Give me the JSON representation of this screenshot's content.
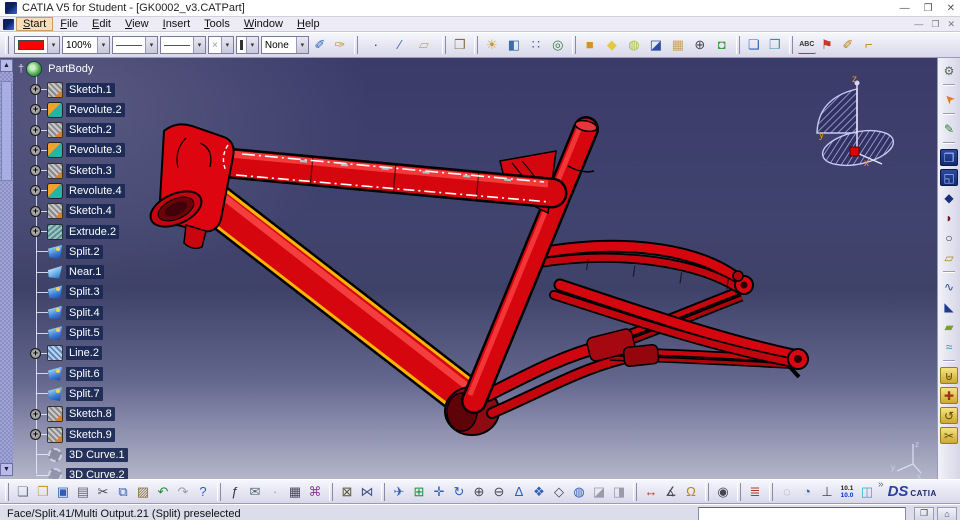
{
  "window": {
    "title": "CATIA V5 for Student - [GK0002_v3.CATPart]",
    "controls": {
      "minimize": "—",
      "restore": "❐",
      "close": "✕"
    }
  },
  "doc_controls": {
    "minimize": "—",
    "restore": "❐",
    "close": "✕"
  },
  "menu": {
    "items": [
      {
        "label": "Start",
        "highlight": true
      },
      {
        "label": "File"
      },
      {
        "label": "Edit"
      },
      {
        "label": "View"
      },
      {
        "label": "Insert"
      },
      {
        "label": "Tools"
      },
      {
        "label": "Window"
      },
      {
        "label": "Help"
      }
    ]
  },
  "graphic_props": {
    "fill_color": "#ff0000",
    "zoom_level": "100%",
    "point_symbol": "×",
    "render_material": "None",
    "dropdown_arrow": "▾"
  },
  "toolbar_icons_a": [
    {
      "name": "painter-icon",
      "glyph": "✐",
      "color": "#2f5fb3"
    },
    {
      "name": "copy-graphic-properties-icon",
      "glyph": "✑",
      "color": "#c99a2e"
    }
  ],
  "toolbar_icons_b": [
    {
      "name": "point-icon",
      "glyph": "·",
      "color": "#16307a"
    },
    {
      "name": "line-icon",
      "glyph": "∕",
      "color": "#2f5fb3"
    },
    {
      "name": "plane-icon",
      "glyph": "▱",
      "color": "#b8b83a"
    }
  ],
  "toolbar_icons_c": [
    {
      "name": "open-box-icon",
      "glyph": "❒",
      "color": "#8a6d3b"
    }
  ],
  "toolbar_icons_d": [
    {
      "name": "light-source-icon",
      "glyph": "☀",
      "color": "#c99a2e"
    },
    {
      "name": "depth-effect-icon",
      "glyph": "◧",
      "color": "#3a6ea5"
    },
    {
      "name": "grid-icon",
      "glyph": "∷",
      "color": "#5555bb"
    },
    {
      "name": "snap-to-point-icon",
      "glyph": "◎",
      "color": "#2e7d32"
    }
  ],
  "toolbar_icons_e": [
    {
      "name": "view-shading-icon",
      "glyph": "■",
      "color": "#d98e2b"
    },
    {
      "name": "view-shading-edges-icon",
      "glyph": "◆",
      "color": "#e2c93f"
    },
    {
      "name": "view-material-icon",
      "glyph": "◍",
      "color": "#a9c13e"
    },
    {
      "name": "view-wireframe-icon",
      "glyph": "◪",
      "color": "#2f4d9e"
    },
    {
      "name": "view-hidden-line-icon",
      "glyph": "▦",
      "color": "#c8a06a"
    },
    {
      "name": "view-perspective-icon",
      "glyph": "⊕",
      "color": "#444455"
    },
    {
      "name": "view-ground-icon",
      "glyph": "◘",
      "color": "#3f9b44"
    }
  ],
  "toolbar_icons_f": [
    {
      "name": "tile-horizontally-icon",
      "glyph": "❏",
      "color": "#2f5fb3"
    },
    {
      "name": "tile-vertically-icon",
      "glyph": "❐",
      "color": "#2f8fb3"
    }
  ],
  "toolbar_icons_g": [
    {
      "name": "flag-note-icon",
      "glyph": "⚑",
      "color": "#c23a2a"
    },
    {
      "name": "annotation-painter-icon",
      "glyph": "✐",
      "color": "#b8860b"
    },
    {
      "name": "key-lock-icon",
      "glyph": "⌐",
      "color": "#b8860b"
    }
  ],
  "abc_label": "ABC",
  "tree": {
    "root": {
      "label": "PartBody",
      "anchor_glyph": "†"
    },
    "items": [
      {
        "label": "Sketch.1",
        "icon": "sketch",
        "expandable": true
      },
      {
        "label": "Revolute.2",
        "icon": "revolute",
        "expandable": true
      },
      {
        "label": "Sketch.2",
        "icon": "sketch",
        "expandable": true
      },
      {
        "label": "Revolute.3",
        "icon": "revolute",
        "expandable": true
      },
      {
        "label": "Sketch.3",
        "icon": "sketch",
        "expandable": true
      },
      {
        "label": "Revolute.4",
        "icon": "revolute",
        "expandable": true
      },
      {
        "label": "Sketch.4",
        "icon": "sketch",
        "expandable": true
      },
      {
        "label": "Extrude.2",
        "icon": "extrude",
        "expandable": true
      },
      {
        "label": "Split.2",
        "icon": "split",
        "expandable": false
      },
      {
        "label": "Near.1",
        "icon": "near",
        "expandable": false
      },
      {
        "label": "Split.3",
        "icon": "split",
        "expandable": false
      },
      {
        "label": "Split.4",
        "icon": "split",
        "expandable": false
      },
      {
        "label": "Split.5",
        "icon": "split",
        "expandable": false
      },
      {
        "label": "Line.2",
        "icon": "line",
        "expandable": true
      },
      {
        "label": "Split.6",
        "icon": "split",
        "expandable": false
      },
      {
        "label": "Split.7",
        "icon": "split",
        "expandable": false
      },
      {
        "label": "Sketch.8",
        "icon": "sketch",
        "expandable": true
      },
      {
        "label": "Sketch.9",
        "icon": "sketch",
        "expandable": true
      },
      {
        "label": "3D Curve.1",
        "icon": "curve3d",
        "expandable": false
      },
      {
        "label": "3D Curve.2",
        "icon": "curve3d",
        "expandable": false
      }
    ],
    "expander_glyph": "+"
  },
  "viewport": {
    "compass": {
      "x": "x",
      "y": "y",
      "z": "z"
    },
    "triad": {
      "x": "x",
      "y": "y",
      "z": "z"
    },
    "frame_color": "#e00713",
    "selected_outline": "#ffb400",
    "centerline_color": "#ffffff"
  },
  "right_tools": [
    {
      "name": "gear-icon",
      "glyph": "⚙",
      "color": "#556655"
    },
    {
      "sep": true
    },
    {
      "name": "select-cursor-icon",
      "glyph": "➤",
      "color": "#e07b20",
      "rot": true
    },
    {
      "sep": true
    },
    {
      "name": "sketcher-icon",
      "glyph": "✎",
      "color": "#2e7d32"
    },
    {
      "sep": true
    },
    {
      "name": "pad-icon",
      "glyph": "❒",
      "color": "#9fb6ff",
      "chip": "chip-navy"
    },
    {
      "name": "pocket-icon",
      "glyph": "◱",
      "color": "#9fb6ff",
      "chip": "chip-navy"
    },
    {
      "name": "split-solid-icon",
      "glyph": "◆",
      "color": "#16307a"
    },
    {
      "name": "close-surface-icon",
      "glyph": "◗",
      "color": "#7a1020"
    },
    {
      "name": "cylinder-icon",
      "glyph": "○",
      "color": "#333344"
    },
    {
      "name": "extrude-surface-icon",
      "glyph": "▱",
      "color": "#a8882a"
    },
    {
      "sep": true
    },
    {
      "name": "sweep-icon",
      "glyph": "∿",
      "color": "#2f4d9e"
    },
    {
      "name": "wedge-icon",
      "glyph": "◣",
      "color": "#1d3a8f"
    },
    {
      "name": "fill-icon",
      "glyph": "▰",
      "color": "#7aa12e"
    },
    {
      "name": "blend-icon",
      "glyph": "≈",
      "color": "#2f8fb3"
    },
    {
      "sep": true
    },
    {
      "name": "join-icon",
      "glyph": "⊎",
      "color": "#5a4a10",
      "chip": "chip-yellow"
    },
    {
      "name": "healing-icon",
      "glyph": "✚",
      "color": "#a03020",
      "chip": "chip-yellow"
    },
    {
      "name": "untrim-icon",
      "glyph": "↺",
      "color": "#5a4a10",
      "chip": "chip-yellow"
    },
    {
      "name": "disassemble-icon",
      "glyph": "✂",
      "color": "#5a4a10",
      "chip": "chip-yellow"
    }
  ],
  "bottom_groups": [
    [
      {
        "name": "new-icon",
        "glyph": "❏",
        "color": "#667788"
      },
      {
        "name": "open-icon",
        "glyph": "❐",
        "color": "#c99a2e"
      },
      {
        "name": "save-icon",
        "glyph": "▣",
        "color": "#2f5fb3"
      },
      {
        "name": "print-icon",
        "glyph": "▤",
        "color": "#666677"
      },
      {
        "name": "cut-icon",
        "glyph": "✂",
        "color": "#444455"
      },
      {
        "name": "copy-icon",
        "glyph": "⧉",
        "color": "#2f5fb3"
      },
      {
        "name": "paste-icon",
        "glyph": "▨",
        "color": "#8a6d3b"
      },
      {
        "name": "undo-icon",
        "glyph": "↶",
        "color": "#1f8a3a"
      },
      {
        "name": "redo-icon",
        "glyph": "↷",
        "color": "#9a9aaa"
      },
      {
        "name": "whats-this-icon",
        "glyph": "?",
        "color": "#2f5fb3"
      }
    ],
    [
      {
        "name": "formula-icon",
        "glyph": "ƒ",
        "color": "#333344"
      },
      {
        "name": "knowledge-icon",
        "glyph": "✉",
        "color": "#556677"
      },
      {
        "name": "parameter-icon",
        "glyph": "·",
        "color": "#9a9aaa"
      },
      {
        "name": "design-table-icon",
        "glyph": "▦",
        "color": "#444455"
      },
      {
        "name": "product-structure-icon",
        "glyph": "⌘",
        "color": "#953a9e"
      }
    ],
    [
      {
        "name": "lock-icon",
        "glyph": "⊠",
        "color": "#555533"
      },
      {
        "name": "links-icon",
        "glyph": "⋈",
        "color": "#445588"
      }
    ],
    [
      {
        "name": "fly-mode-icon",
        "glyph": "✈",
        "color": "#2f5fb3"
      },
      {
        "name": "fit-all-in-icon",
        "glyph": "⊞",
        "color": "#1f8a3a"
      },
      {
        "name": "pan-icon",
        "glyph": "✛",
        "color": "#2f5fb3"
      },
      {
        "name": "rotate-icon",
        "glyph": "↻",
        "color": "#2f5fb3"
      },
      {
        "name": "zoom-in-icon",
        "glyph": "⊕",
        "color": "#444455"
      },
      {
        "name": "zoom-out-icon",
        "glyph": "⊖",
        "color": "#444455"
      },
      {
        "name": "normal-view-icon",
        "glyph": "∆",
        "color": "#2f5fb3"
      },
      {
        "name": "multi-view-icon",
        "glyph": "❖",
        "color": "#2f5fb3"
      },
      {
        "name": "iso-view-icon",
        "glyph": "◇",
        "color": "#444455"
      },
      {
        "name": "render-style-icon",
        "glyph": "◍",
        "color": "#2f5fb3"
      },
      {
        "name": "hide-show-icon",
        "glyph": "◪",
        "color": "#9a9aaa"
      },
      {
        "name": "swap-space-icon",
        "glyph": "◨",
        "color": "#9a9aaa"
      }
    ],
    [
      {
        "name": "measure-between-icon",
        "glyph": "↔",
        "color": "#b33a2a"
      },
      {
        "name": "measure-item-icon",
        "glyph": "∡",
        "color": "#444455"
      },
      {
        "name": "mass-properties-icon",
        "glyph": "Ω",
        "color": "#b8860b"
      }
    ],
    [
      {
        "name": "capture-icon",
        "glyph": "◉",
        "color": "#444455"
      }
    ],
    [
      {
        "name": "gauge-icon",
        "glyph": "≣",
        "color": "#b33a2a"
      }
    ],
    [
      {
        "name": "recycle-icon",
        "glyph": "◌",
        "color": "#9a9aaa"
      },
      {
        "name": "update-icon",
        "glyph": "◔",
        "color": "#2f5fb3"
      },
      {
        "name": "axis-system-icon",
        "glyph": "⊥",
        "color": "#444455"
      },
      {
        "name": "units-icon",
        "units": true
      },
      {
        "name": "catalog-icon",
        "glyph": "◫",
        "color": "#28b0c9"
      }
    ]
  ],
  "units_icon": {
    "top": "10.1",
    "bottom": "10.0"
  },
  "chevron": "»",
  "logo": {
    "ds": "DS",
    "catia": "CATIA"
  },
  "status": {
    "message": "Face/Split.41/Multi Output.21 (Split) preselected",
    "input_value": "",
    "buttons": [
      {
        "name": "power-input-expand-button",
        "glyph": "❐"
      },
      {
        "name": "power-input-history-button",
        "glyph": "⌂"
      }
    ]
  }
}
